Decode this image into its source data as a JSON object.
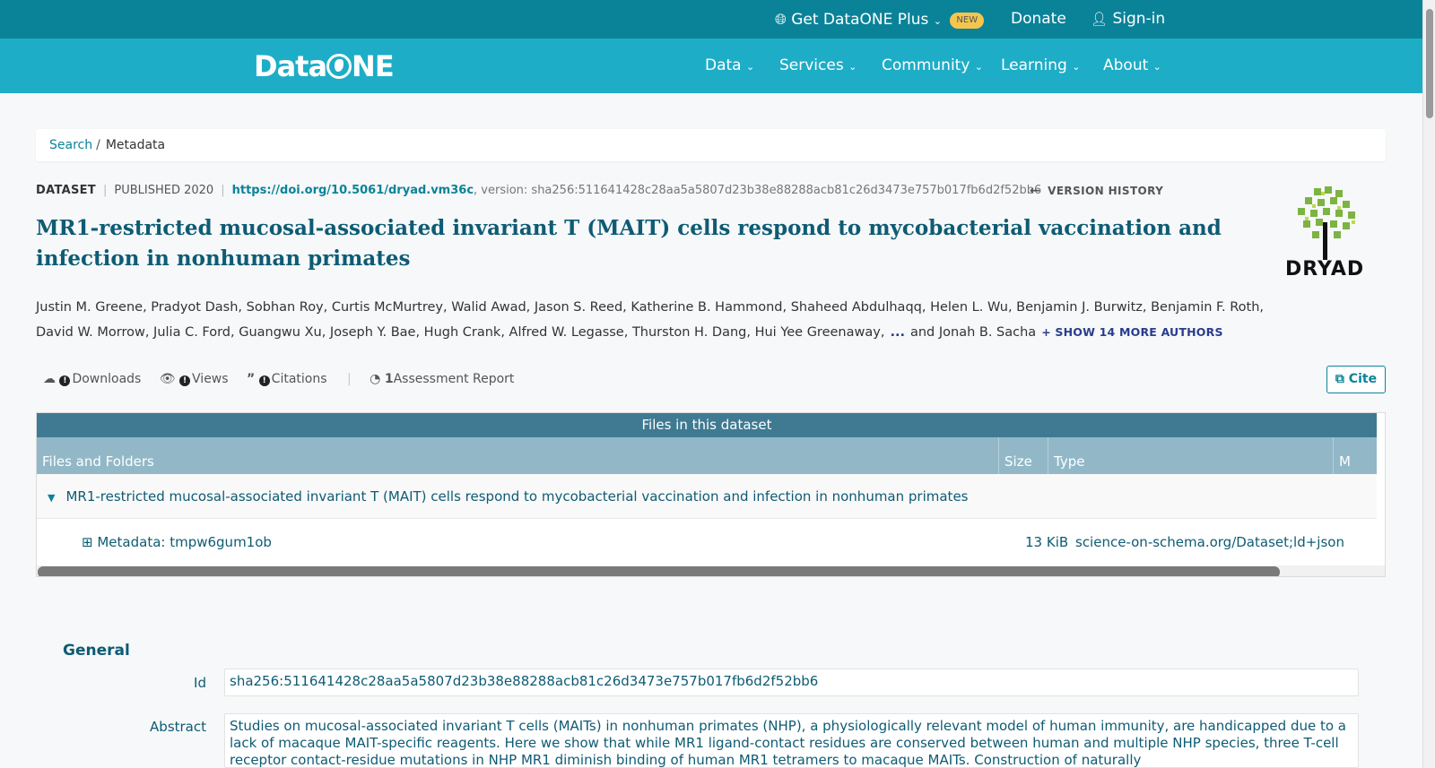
{
  "topbar": {
    "plus_label": "Get DataONE Plus",
    "new_badge": "NEW",
    "donate": "Donate",
    "signin": "Sign-in"
  },
  "navbar": {
    "logo": "DataONE",
    "items": [
      "Data",
      "Services",
      "Community",
      "Learning",
      "About"
    ]
  },
  "breadcrumb": {
    "search": "Search",
    "separator": "/",
    "current": "Metadata"
  },
  "meta": {
    "type": "DATASET",
    "published": "PUBLISHED 2020",
    "doi": "https://doi.org/10.5061/dryad.vm36c",
    "version": ", version: sha256:511641428c28aa5a5807d23b38e88288acb81c26d3473e757b017fb6d2f52bb6",
    "version_history": "VERSION HISTORY"
  },
  "title": "MR1-restricted mucosal-associated invariant T (MAIT) cells respond to mycobacterial vaccination and infection in nonhuman primates",
  "repository_logo_text": "DRYAD",
  "authors": {
    "list": "Justin M. Greene, Pradyot Dash, Sobhan Roy, Curtis McMurtrey, Walid Awad, Jason S. Reed, Katherine B. Hammond, Shaheed Abdulhaqq, Helen L. Wu, Benjamin J. Burwitz, Benjamin F. Roth, David W. Morrow, Julia C. Ford, Guangwu Xu, Joseph Y. Bae, Hugh Crank, Alfred W. Legasse, Thurston H. Dang, Hui Yee Greenaway,",
    "ellipsis": "...",
    "last": "and Jonah B. Sacha",
    "show_more": "+ SHOW 14 MORE AUTHORS"
  },
  "stats": {
    "downloads": "Downloads",
    "views": "Views",
    "citations": "Citations",
    "assessment_count": "1",
    "assessment": "Assessment Report",
    "cite": "Cite"
  },
  "files": {
    "heading": "Files in this dataset",
    "columns": [
      "Files and Folders",
      "Size",
      "Type",
      "M"
    ],
    "folder_name": "MR1-restricted mucosal-associated invariant T (MAIT) cells respond to mycobacterial vaccination and infection in nonhuman primates",
    "file_name": "Metadata: tmpw6gum1ob",
    "file_size": "13 KiB",
    "file_type": "science-on-schema.org/Dataset;ld+json"
  },
  "general": {
    "heading": "General",
    "id_label": "Id",
    "id_value": "sha256:511641428c28aa5a5807d23b38e88288acb81c26d3473e757b017fb6d2f52bb6",
    "abstract_label": "Abstract",
    "abstract_value": "Studies on mucosal-associated invariant T cells (MAITs) in nonhuman primates (NHP), a physiologically relevant model of human immunity, are handicapped due to a lack of macaque MAIT-specific reagents. Here we show that while MR1 ligand-contact residues are conserved between human and multiple NHP species, three T-cell receptor contact-residue mutations in NHP MR1 diminish binding of human MR1 tetramers to macaque MAITs. Construction of naturally"
  },
  "colors": {
    "topbar": "#0a8399",
    "navbar": "#1eadc7",
    "title": "#0e5b74",
    "link": "#0a8399",
    "table_header": "#3f7a92",
    "table_columns": "#92b8c8"
  }
}
